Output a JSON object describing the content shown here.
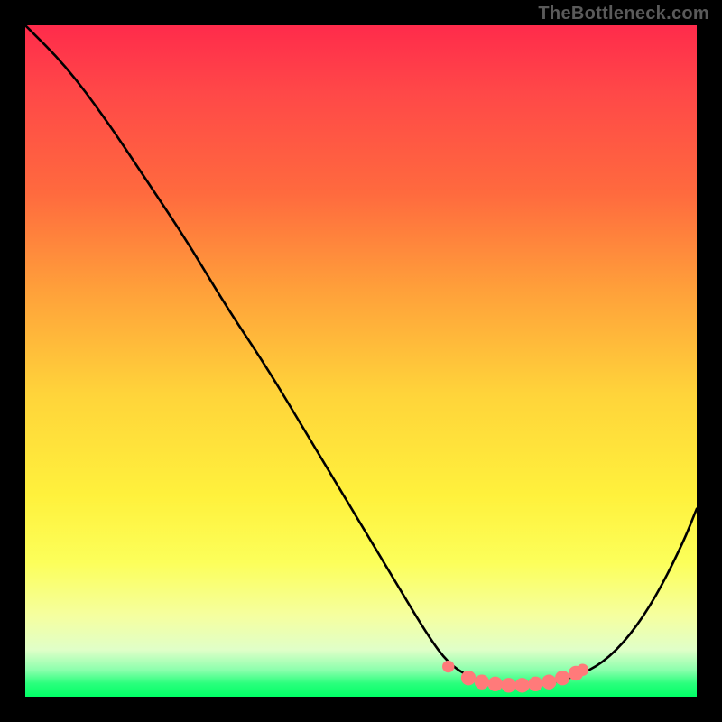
{
  "watermark": "TheBottleneck.com",
  "chart_data": {
    "type": "line",
    "title": "",
    "xlabel": "",
    "ylabel": "",
    "xlim": [
      0,
      100
    ],
    "ylim": [
      0,
      100
    ],
    "series": [
      {
        "name": "curve",
        "x": [
          0,
          6,
          12,
          18,
          24,
          30,
          36,
          42,
          48,
          54,
          60,
          63,
          66,
          69,
          72,
          75,
          78,
          82,
          86,
          90,
          94,
          98,
          100
        ],
        "y": [
          100,
          94,
          86,
          77,
          68,
          58,
          49,
          39,
          29,
          19,
          9,
          5,
          3,
          2,
          1.5,
          1.5,
          2,
          3,
          5,
          9,
          15,
          23,
          28
        ]
      }
    ],
    "markers": {
      "name": "highlight-points",
      "color": "#ff7a7a",
      "points": [
        {
          "x": 63,
          "y": 4.5,
          "r": 0.9
        },
        {
          "x": 66,
          "y": 2.8,
          "r": 1.1
        },
        {
          "x": 68,
          "y": 2.2,
          "r": 1.1
        },
        {
          "x": 70,
          "y": 1.9,
          "r": 1.1
        },
        {
          "x": 72,
          "y": 1.7,
          "r": 1.1
        },
        {
          "x": 74,
          "y": 1.7,
          "r": 1.1
        },
        {
          "x": 76,
          "y": 1.9,
          "r": 1.1
        },
        {
          "x": 78,
          "y": 2.2,
          "r": 1.1
        },
        {
          "x": 80,
          "y": 2.8,
          "r": 1.1
        },
        {
          "x": 82,
          "y": 3.5,
          "r": 1.1
        },
        {
          "x": 83,
          "y": 4.0,
          "r": 0.9
        }
      ]
    },
    "gradient_background": {
      "type": "vertical",
      "stops": [
        {
          "pos": 0,
          "color": "#ff2b4b"
        },
        {
          "pos": 25,
          "color": "#ff6a3e"
        },
        {
          "pos": 55,
          "color": "#ffd43a"
        },
        {
          "pos": 80,
          "color": "#fcff5a"
        },
        {
          "pos": 96,
          "color": "#8cffad"
        },
        {
          "pos": 100,
          "color": "#00ff66"
        }
      ]
    }
  }
}
